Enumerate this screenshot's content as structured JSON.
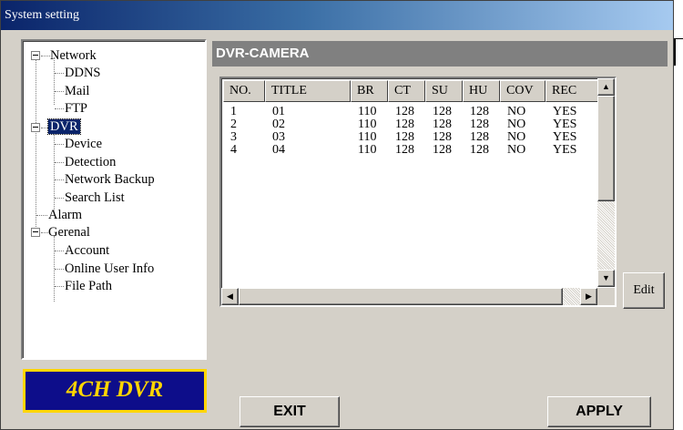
{
  "window": {
    "title": "System setting"
  },
  "tree": {
    "items": [
      {
        "label": "Network",
        "expanded": true
      },
      {
        "label": "DDNS"
      },
      {
        "label": "Mail"
      },
      {
        "label": "FTP"
      },
      {
        "label": "DVR",
        "expanded": true,
        "selected": true
      },
      {
        "label": "Device"
      },
      {
        "label": "Detection"
      },
      {
        "label": "Network Backup"
      },
      {
        "label": "Search List"
      },
      {
        "label": "Alarm"
      },
      {
        "label": "Gerenal",
        "expanded": true
      },
      {
        "label": "Account"
      },
      {
        "label": "Online User Info"
      },
      {
        "label": "File Path"
      }
    ]
  },
  "logo": {
    "text": "4CH DVR"
  },
  "content": {
    "header": "DVR-CAMERA"
  },
  "table": {
    "columns": [
      "NO.",
      "TITLE",
      "BR",
      "CT",
      "SU",
      "HU",
      "COV",
      "REC"
    ],
    "rows": [
      [
        "1",
        "01",
        "110",
        "128",
        "128",
        "128",
        "NO",
        "YES"
      ],
      [
        "2",
        "02",
        "110",
        "128",
        "128",
        "128",
        "NO",
        "YES"
      ],
      [
        "3",
        "03",
        "110",
        "128",
        "128",
        "128",
        "NO",
        "YES"
      ],
      [
        "4",
        "04",
        "110",
        "128",
        "128",
        "128",
        "NO",
        "YES"
      ]
    ]
  },
  "buttons": {
    "edit": "Edit",
    "exit": "EXIT",
    "apply": "APPLY"
  },
  "colors": {
    "selection": "#0a246a",
    "logo_bg": "#0d0d8a",
    "logo_fg": "#ffd600",
    "header_bg": "#808080"
  }
}
